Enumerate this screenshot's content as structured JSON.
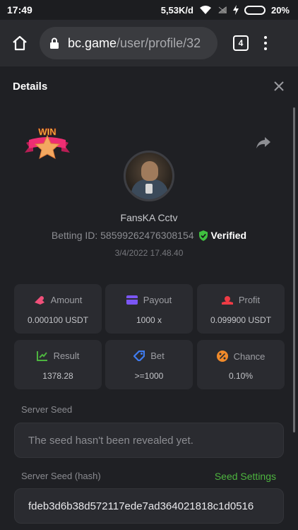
{
  "status_bar": {
    "time": "17:49",
    "network_speed": "5,53K/d",
    "battery_percent": "20%",
    "battery_level": 0.2
  },
  "browser": {
    "url_domain": "bc.game",
    "url_path": "/user/profile/32",
    "tab_count": "4"
  },
  "details": {
    "title": "Details"
  },
  "profile": {
    "username": "FansKA Cctv",
    "betting_id": "Betting ID: 58599262476308154",
    "verified_label": "Verified",
    "date": "3/4/2022 17.48.40"
  },
  "stats": [
    {
      "label": "Amount",
      "value": "0.000100 USDT",
      "icon": "amount-icon",
      "color": "#f0507a"
    },
    {
      "label": "Payout",
      "value": "1000 x",
      "icon": "payout-icon",
      "color": "#7b56f5"
    },
    {
      "label": "Profit",
      "value": "0.099900 USDT",
      "icon": "profit-icon",
      "color": "#ee3b45"
    },
    {
      "label": "Result",
      "value": "1378.28",
      "icon": "result-icon",
      "color": "#4db43f"
    },
    {
      "label": "Bet",
      "value": ">=1000",
      "icon": "bet-icon",
      "color": "#3f7cf0"
    },
    {
      "label": "Chance",
      "value": "0.10%",
      "icon": "chance-icon",
      "color": "#f08a2a"
    }
  ],
  "server_seed": {
    "label": "Server Seed",
    "value": "The seed hasn't been revealed yet."
  },
  "server_seed_hash": {
    "label": "Server Seed (hash)",
    "link": "Seed Settings",
    "value": "fdeb3d6b38d572117ede7ad364021818c1d0516"
  },
  "badge": {
    "text": "WIN"
  },
  "colors": {
    "accent_green": "#4db43f",
    "verified_green": "#3fbf3f"
  }
}
